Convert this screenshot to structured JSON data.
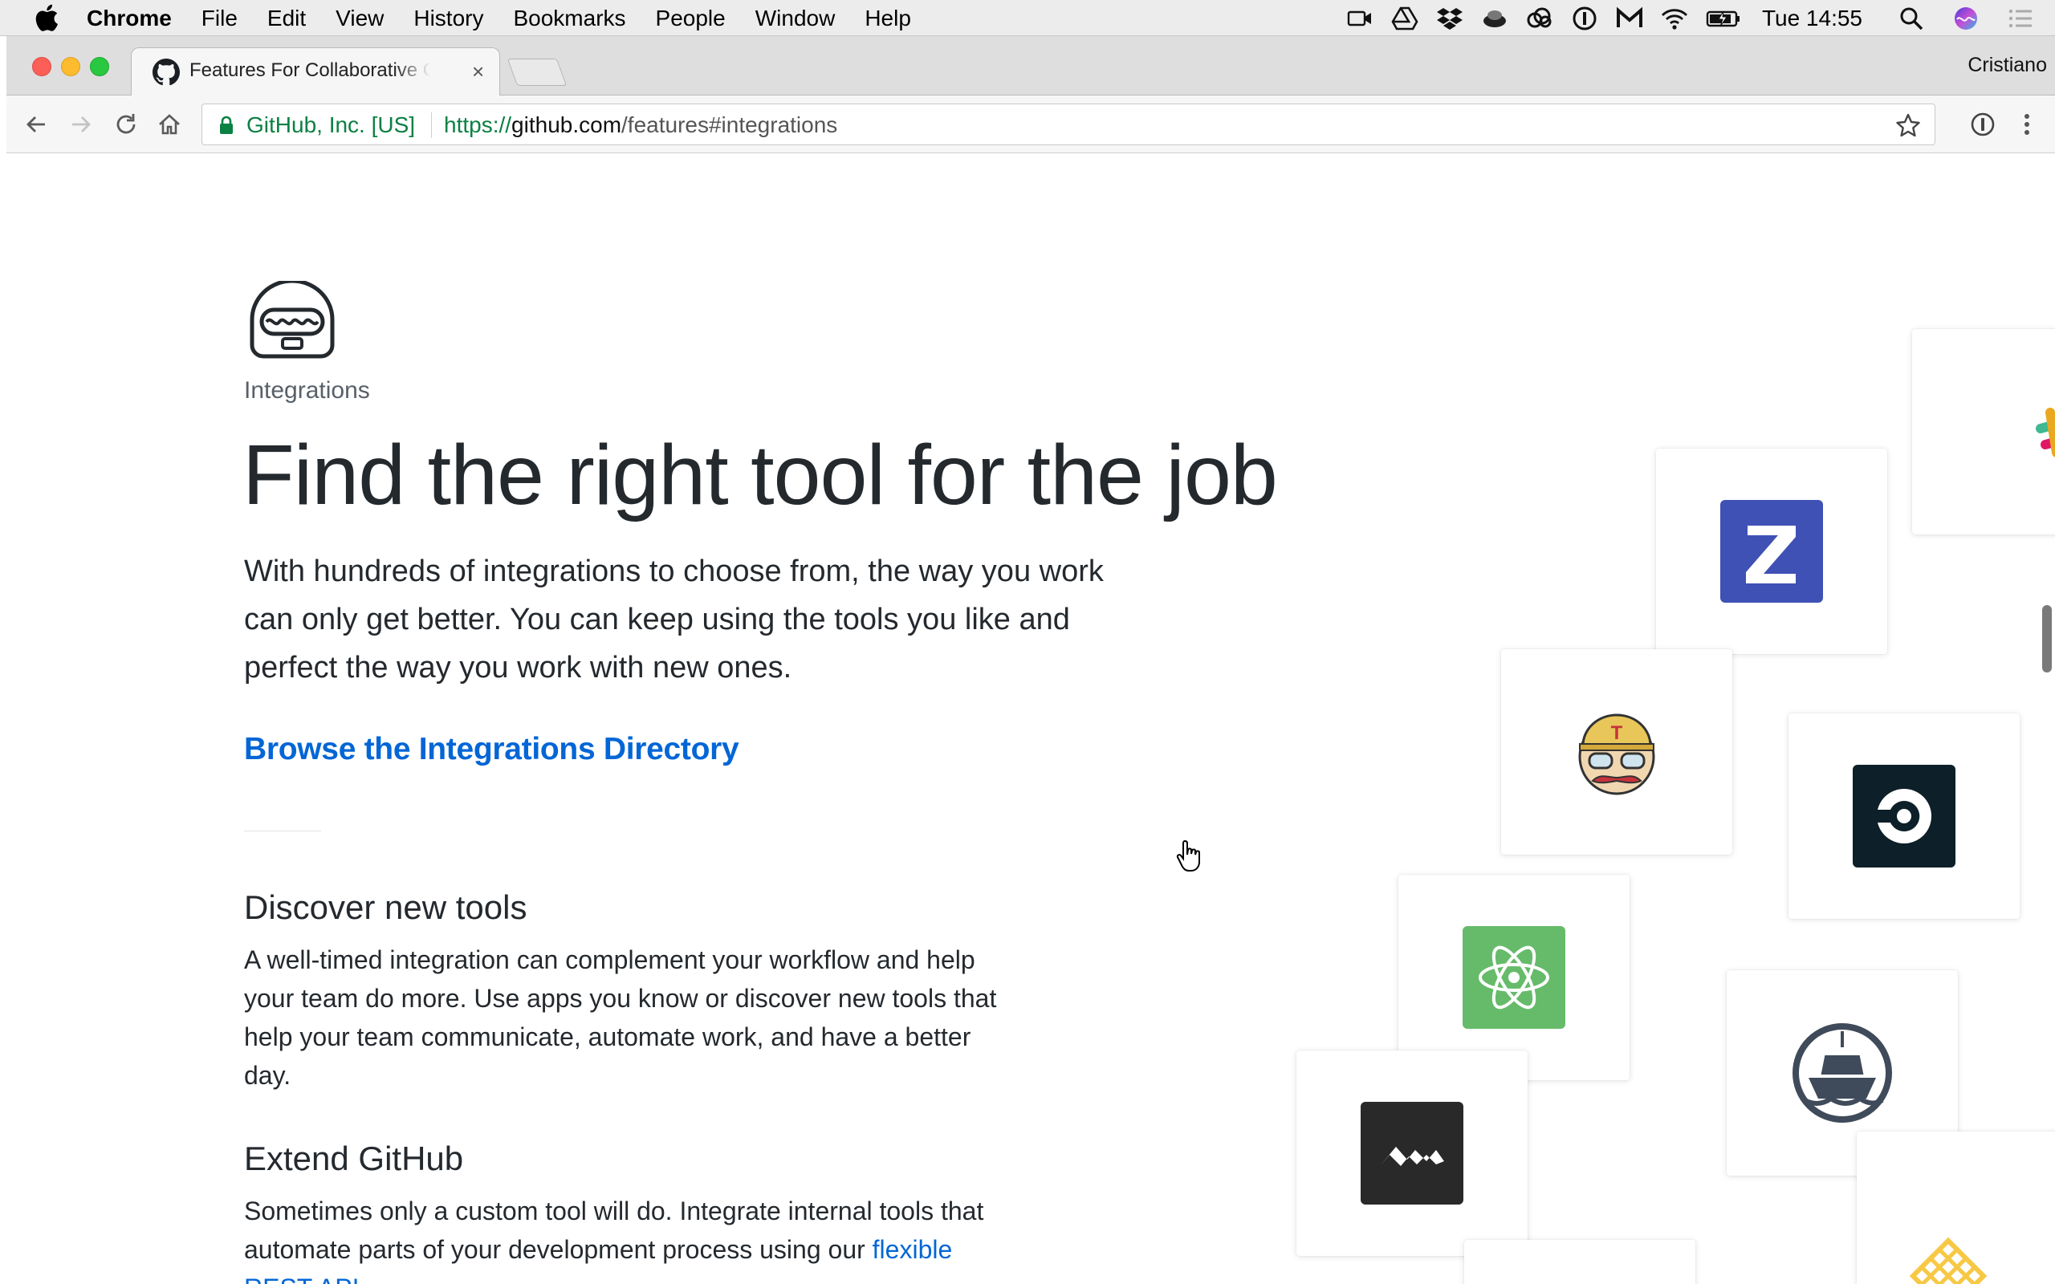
{
  "menubar": {
    "app_name": "Chrome",
    "items": [
      "File",
      "Edit",
      "View",
      "History",
      "Bookmarks",
      "People",
      "Window",
      "Help"
    ],
    "clock": "Tue 14:55",
    "status_icons": [
      "screen-record-icon",
      "google-drive-icon",
      "dropbox-icon",
      "cloud-app-icon",
      "creative-cloud-icon",
      "onepassword-icon",
      "gmail-icon",
      "wifi-icon",
      "battery-icon",
      "spotlight-icon",
      "siri-icon",
      "notification-center-icon"
    ]
  },
  "browser": {
    "tab_title": "Features For Collaborative Coding",
    "profile_name": "Cristiano",
    "ev_cert": "GitHub, Inc. [US]",
    "url_scheme": "https://",
    "url_host": "github.com",
    "url_path": "/features#integrations"
  },
  "content": {
    "eyebrow": "Integrations",
    "headline": "Find the right tool for the job",
    "lead": "With hundreds of integrations to choose from, the way you work can only get better. You can keep using the tools you like and perfect the way you work with new ones.",
    "browse_link": "Browse the Integrations Directory",
    "discover_title": "Discover new tools",
    "discover_body": "A well-timed integration can complement your workflow and help your team do more. Use apps you know or discover new tools that help your team communicate, automate work, and have a better day.",
    "extend_title": "Extend GitHub",
    "extend_body_1": "Sometimes only a custom tool will do. Integrate internal tools that automate parts of your development process using our",
    "extend_body_link": "flexible REST API"
  },
  "integration_cards": [
    {
      "name": "slack",
      "color": "#ffffff"
    },
    {
      "name": "zenhub",
      "color": "#3f51b5"
    },
    {
      "name": "travis-ci",
      "color": "#ffffff"
    },
    {
      "name": "circleci",
      "color": "#0d1f28"
    },
    {
      "name": "atom",
      "color": "#66bb6a"
    },
    {
      "name": "waffle",
      "color": "#ffffff"
    },
    {
      "name": "codacy",
      "color": "#292929"
    },
    {
      "name": "codecov",
      "color": "#f7c844"
    }
  ],
  "colors": {
    "link": "#0366d6",
    "text": "#24292e",
    "muted": "#586069",
    "secure_green": "#0b8043"
  }
}
